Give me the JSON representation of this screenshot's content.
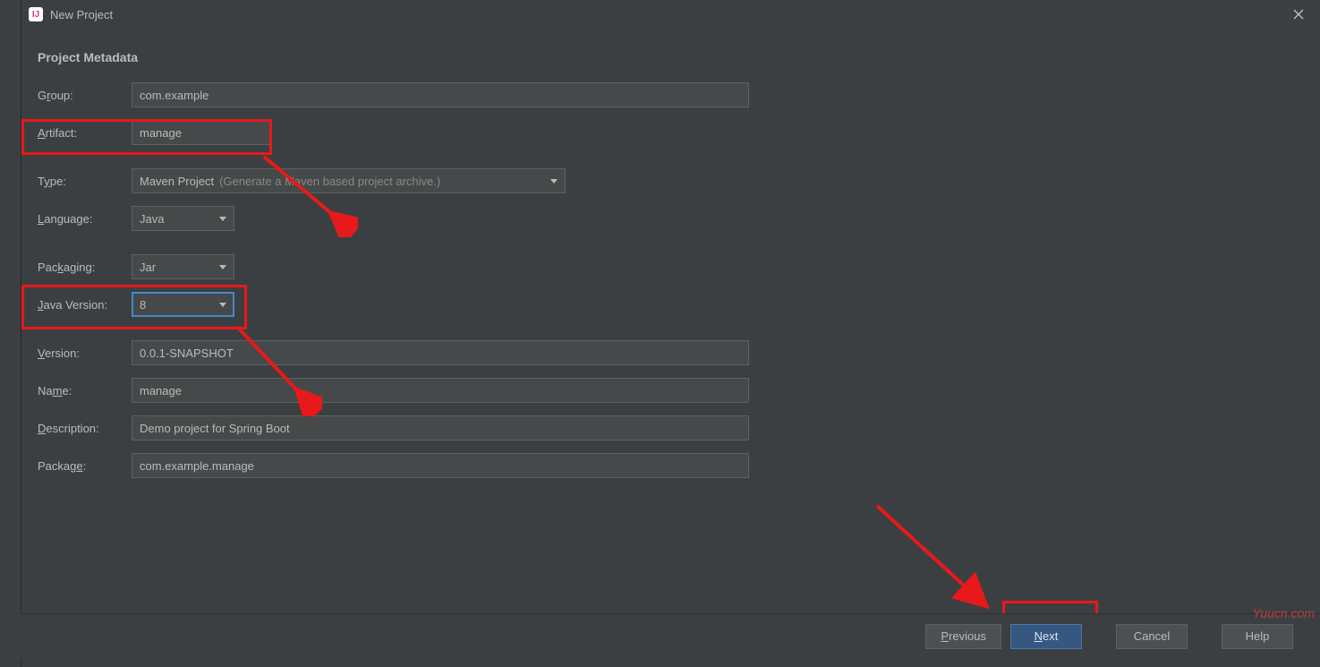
{
  "window": {
    "title": "New Project"
  },
  "section_title": "Project Metadata",
  "fields": {
    "group": {
      "label_pre": "G",
      "label_mn": "r",
      "label_post": "oup:",
      "value": "com.example"
    },
    "artifact": {
      "label_pre": "",
      "label_mn": "A",
      "label_post": "rtifact:",
      "value": "manage"
    },
    "type": {
      "label_pre": "T",
      "label_mn": "y",
      "label_post": "pe:",
      "value": "Maven Project",
      "hint": "(Generate a Maven based project archive.)"
    },
    "language": {
      "label_pre": "",
      "label_mn": "L",
      "label_post": "anguage:",
      "value": "Java"
    },
    "packaging": {
      "label_pre": "Pac",
      "label_mn": "k",
      "label_post": "aging:",
      "value": "Jar"
    },
    "java_version": {
      "label_pre": "",
      "label_mn": "J",
      "label_post": "ava Version:",
      "value": "8"
    },
    "version": {
      "label_pre": "",
      "label_mn": "V",
      "label_post": "ersion:",
      "value": "0.0.1-SNAPSHOT"
    },
    "name": {
      "label_pre": "Na",
      "label_mn": "m",
      "label_post": "e:",
      "value": "manage"
    },
    "description": {
      "label_pre": "",
      "label_mn": "D",
      "label_post": "escription:",
      "value": "Demo project for Spring Boot"
    },
    "package": {
      "label_pre": "Packag",
      "label_mn": "e",
      "label_post": ":",
      "value": "com.example.manage"
    }
  },
  "buttons": {
    "previous": {
      "mn": "P",
      "rest": "revious"
    },
    "next": {
      "mn": "N",
      "rest": "ext"
    },
    "cancel": "Cancel",
    "help": "Help"
  },
  "watermark": "Yuucn.com"
}
